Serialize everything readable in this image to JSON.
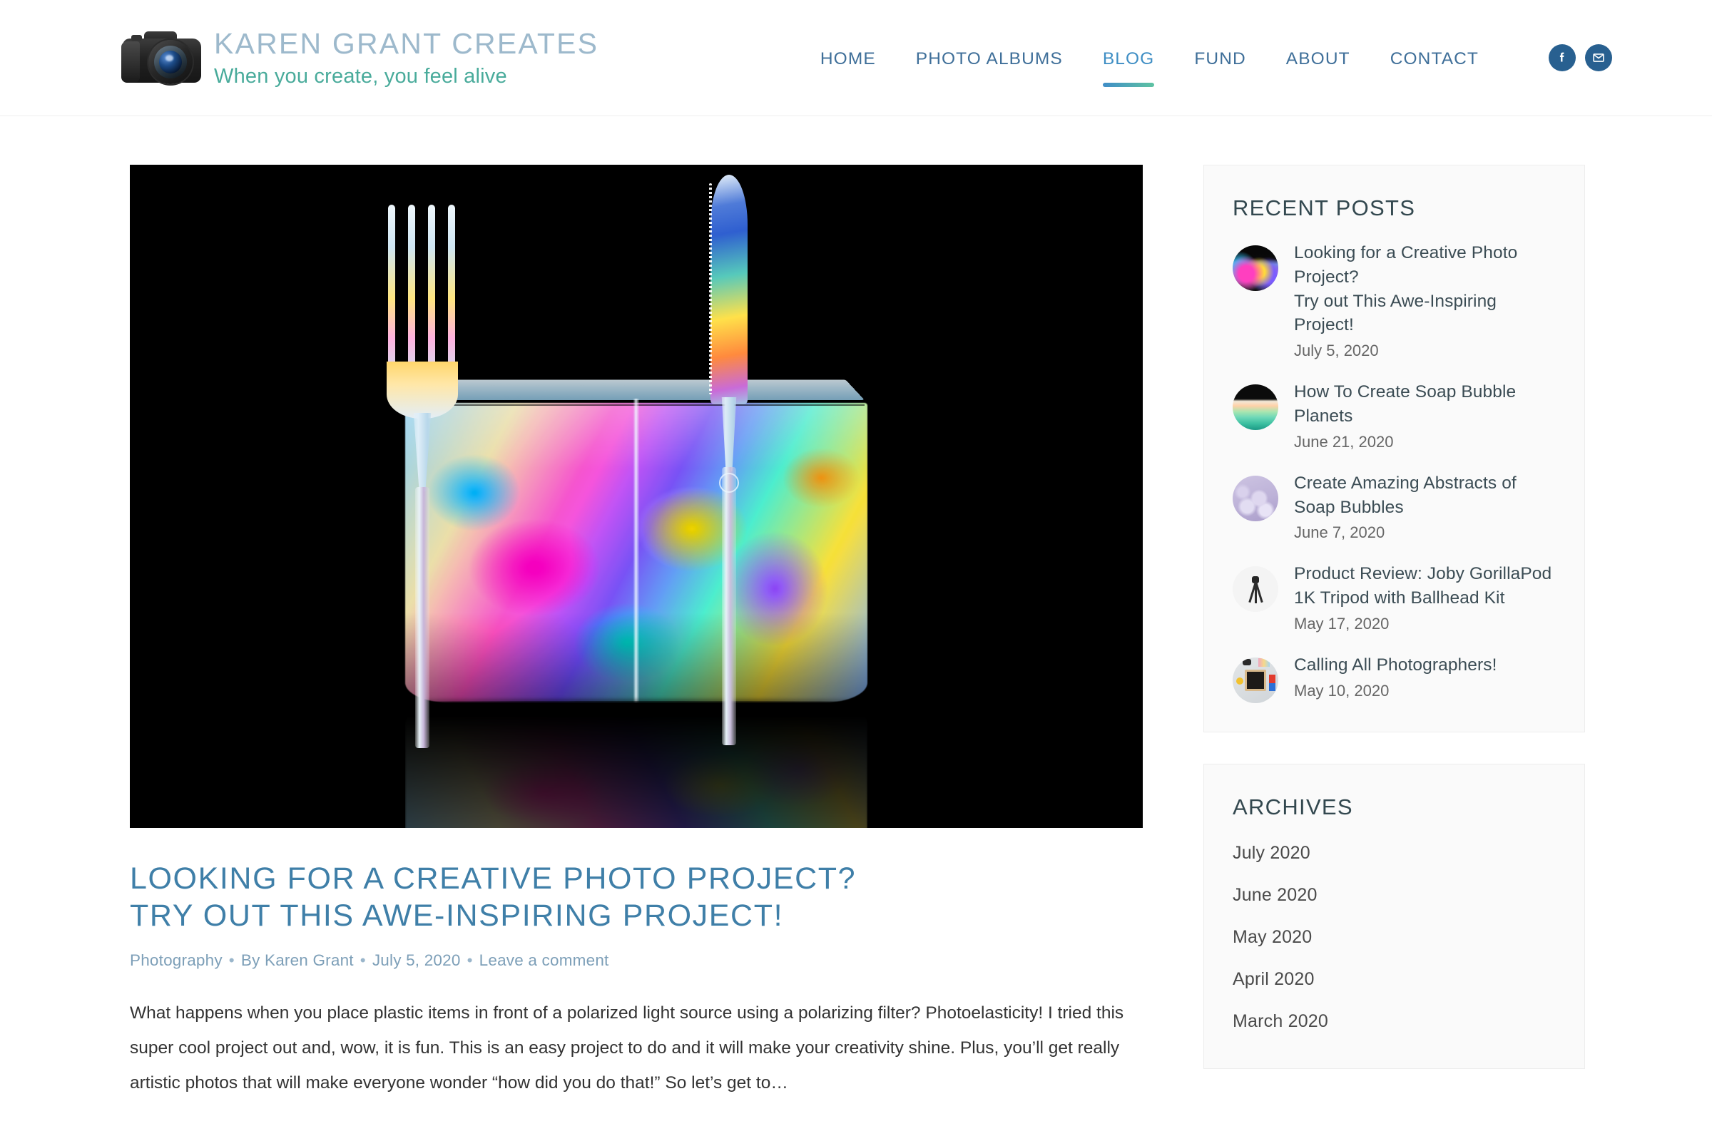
{
  "header": {
    "brand_title": "KAREN GRANT CREATES",
    "brand_tagline": "When you create, you feel alive",
    "logo_icon": "camera-icon",
    "nav": [
      {
        "label": "HOME",
        "active": false
      },
      {
        "label": "PHOTO ALBUMS",
        "active": false
      },
      {
        "label": "BLOG",
        "active": true
      },
      {
        "label": "FUND",
        "active": false
      },
      {
        "label": "ABOUT",
        "active": false
      },
      {
        "label": "CONTACT",
        "active": false
      }
    ],
    "social": [
      {
        "name": "facebook-icon",
        "label": "f"
      },
      {
        "name": "email-icon",
        "label": "envelope"
      }
    ],
    "accent_gradient_from": "#3f8dc7",
    "accent_gradient_to": "#5ec3a2"
  },
  "post": {
    "featured_image_alt": "Clear plastic fork and knife in clear plastic containers photographed with polarized light showing rainbow photoelastic stress colors on a black background",
    "title_line1": "LOOKING FOR A CREATIVE PHOTO PROJECT?",
    "title_line2": "TRY OUT THIS AWE-INSPIRING PROJECT!",
    "meta": {
      "category": "Photography",
      "by_line": "By Karen Grant",
      "date": "July 5, 2020",
      "comments": "Leave a comment",
      "separator": "•"
    },
    "excerpt": "What happens when you place plastic items in front of a polarized light source using a polarizing filter? Photoelasticity! I tried this super cool project out and, wow, it is fun. This is an easy project to do and it will make your creativity shine. Plus, you’ll get really artistic photos that will make everyone wonder “how did you do that!” So let’s get to…"
  },
  "sidebar": {
    "recent_posts": {
      "title": "RECENT POSTS",
      "items": [
        {
          "title": "Looking for a Creative Photo Project?\nTry out This Awe-Inspiring Project!",
          "date": "July 5, 2020",
          "thumb": "photoelasticity-thumb"
        },
        {
          "title": "How To Create Soap Bubble Planets",
          "date": "June 21, 2020",
          "thumb": "soap-bubble-planet-thumb"
        },
        {
          "title": "Create Amazing Abstracts of Soap Bubbles",
          "date": "June 7, 2020",
          "thumb": "soap-bubble-abstract-thumb"
        },
        {
          "title": "Product Review: Joby GorillaPod 1K Tripod with Ballhead Kit",
          "date": "May 17, 2020",
          "thumb": "tripod-thumb"
        },
        {
          "title": "Calling All Photographers!",
          "date": "May 10, 2020",
          "thumb": "letterboard-flatlay-thumb"
        }
      ]
    },
    "archives": {
      "title": "ARCHIVES",
      "items": [
        "July 2020",
        "June 2020",
        "May 2020",
        "April 2020",
        "March 2020"
      ]
    }
  },
  "colors": {
    "brand_blue": "#9db9cc",
    "brand_teal": "#49ab9b",
    "nav_blue": "#3f6f99",
    "nav_active_blue": "#3e8ec4",
    "title_blue": "#3f7fa8",
    "meta_blue": "#7d9fb8",
    "social_blue": "#286090",
    "widget_bg": "#fafafa",
    "widget_border": "#ededed",
    "body_text": "#333333"
  }
}
